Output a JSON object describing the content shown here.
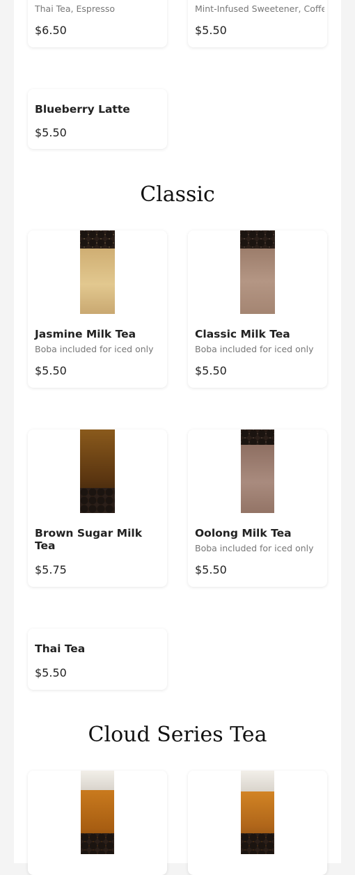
{
  "top_cards": [
    {
      "description": "Thai Tea, Espresso",
      "price": "$6.50"
    },
    {
      "description": "Mint-Infused Sweetener, Coffee",
      "price": "$5.50"
    }
  ],
  "special": {
    "name": "Blueberry Latte",
    "price": "$5.50"
  },
  "classic": {
    "title": "Classic",
    "items": [
      {
        "name": "Jasmine Milk Tea",
        "description": "Boba included for iced only",
        "price": "$5.50"
      },
      {
        "name": "Classic Milk Tea",
        "description": "Boba included for iced only",
        "price": "$5.50"
      },
      {
        "name": "Brown Sugar Milk Tea",
        "description": "",
        "price": "$5.75"
      },
      {
        "name": "Oolong Milk Tea",
        "description": "Boba included for iced only",
        "price": "$5.50"
      },
      {
        "name": "Thai Tea",
        "price": "$5.50"
      }
    ]
  },
  "cloud": {
    "title": "Cloud Series Tea"
  },
  "colors": {
    "jasmine": "#d6b77d",
    "classic": "#a98a78",
    "brown_sugar": "#7a4a12",
    "oolong": "#9e8073",
    "cloud": "#b86d18"
  }
}
